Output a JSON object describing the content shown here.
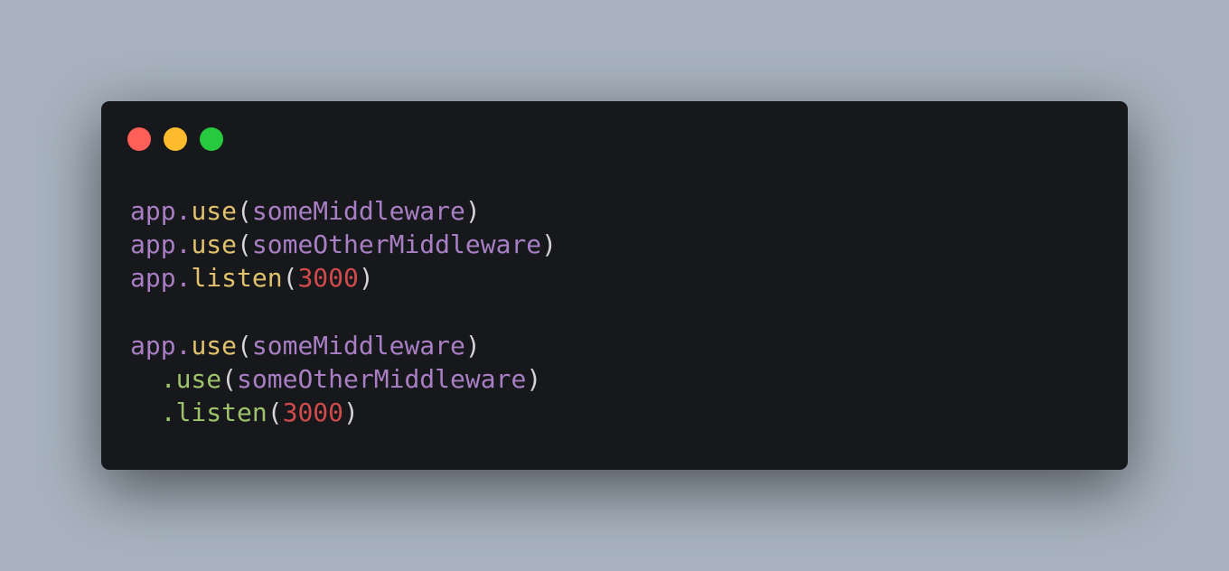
{
  "window": {
    "controls": [
      {
        "name": "close",
        "color": "#ff5f56"
      },
      {
        "name": "minimize",
        "color": "#ffbd2e"
      },
      {
        "name": "maximize",
        "color": "#27c93f"
      }
    ]
  },
  "code": {
    "lines": [
      [
        {
          "text": "app",
          "type": "obj"
        },
        {
          "text": ".",
          "type": "obj"
        },
        {
          "text": "use",
          "type": "fn"
        },
        {
          "text": "(",
          "type": "punct"
        },
        {
          "text": "someMiddleware",
          "type": "arg"
        },
        {
          "text": ")",
          "type": "punct"
        }
      ],
      [
        {
          "text": "app",
          "type": "obj"
        },
        {
          "text": ".",
          "type": "obj"
        },
        {
          "text": "use",
          "type": "fn"
        },
        {
          "text": "(",
          "type": "punct"
        },
        {
          "text": "someOtherMiddleware",
          "type": "arg"
        },
        {
          "text": ")",
          "type": "punct"
        }
      ],
      [
        {
          "text": "app",
          "type": "obj"
        },
        {
          "text": ".",
          "type": "obj"
        },
        {
          "text": "listen",
          "type": "fn"
        },
        {
          "text": "(",
          "type": "punct"
        },
        {
          "text": "3000",
          "type": "num"
        },
        {
          "text": ")",
          "type": "punct"
        }
      ],
      [],
      [
        {
          "text": "app",
          "type": "obj"
        },
        {
          "text": ".",
          "type": "obj"
        },
        {
          "text": "use",
          "type": "fn"
        },
        {
          "text": "(",
          "type": "punct"
        },
        {
          "text": "someMiddleware",
          "type": "arg"
        },
        {
          "text": ")",
          "type": "punct"
        }
      ],
      [
        {
          "text": "  ",
          "type": "punct"
        },
        {
          "text": ".use",
          "type": "chain"
        },
        {
          "text": "(",
          "type": "punct"
        },
        {
          "text": "someOtherMiddleware",
          "type": "arg"
        },
        {
          "text": ")",
          "type": "punct"
        }
      ],
      [
        {
          "text": "  ",
          "type": "punct"
        },
        {
          "text": ".listen",
          "type": "chain"
        },
        {
          "text": "(",
          "type": "punct"
        },
        {
          "text": "3000",
          "type": "num"
        },
        {
          "text": ")",
          "type": "punct"
        }
      ]
    ]
  }
}
